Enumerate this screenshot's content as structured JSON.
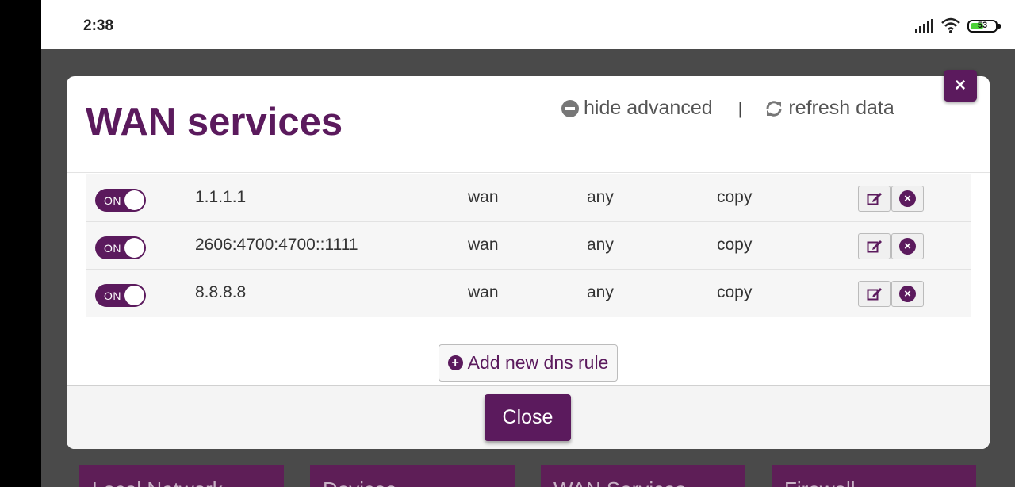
{
  "status_bar": {
    "time": "2:38",
    "battery": "53",
    "battery_level": 0.53
  },
  "background_tiles": [
    "Local Network",
    "Devices",
    "WAN Services",
    "Firewall"
  ],
  "modal": {
    "title": "WAN services",
    "hide_advanced": "hide advanced",
    "separator": "|",
    "refresh_data": "refresh data",
    "close_x": "×",
    "add_rule": "Add new dns rule",
    "close": "Close"
  },
  "rules": [
    {
      "toggle": "ON",
      "address": "1.1.1.1",
      "interface": "wan",
      "protocol": "any",
      "mode": "copy"
    },
    {
      "toggle": "ON",
      "address": "2606:4700:4700::1111",
      "interface": "wan",
      "protocol": "any",
      "mode": "copy"
    },
    {
      "toggle": "ON",
      "address": "8.8.8.8",
      "interface": "wan",
      "protocol": "any",
      "mode": "copy"
    }
  ],
  "colors": {
    "accent": "#5b1a5d",
    "backdrop": "#4a4a4a"
  }
}
